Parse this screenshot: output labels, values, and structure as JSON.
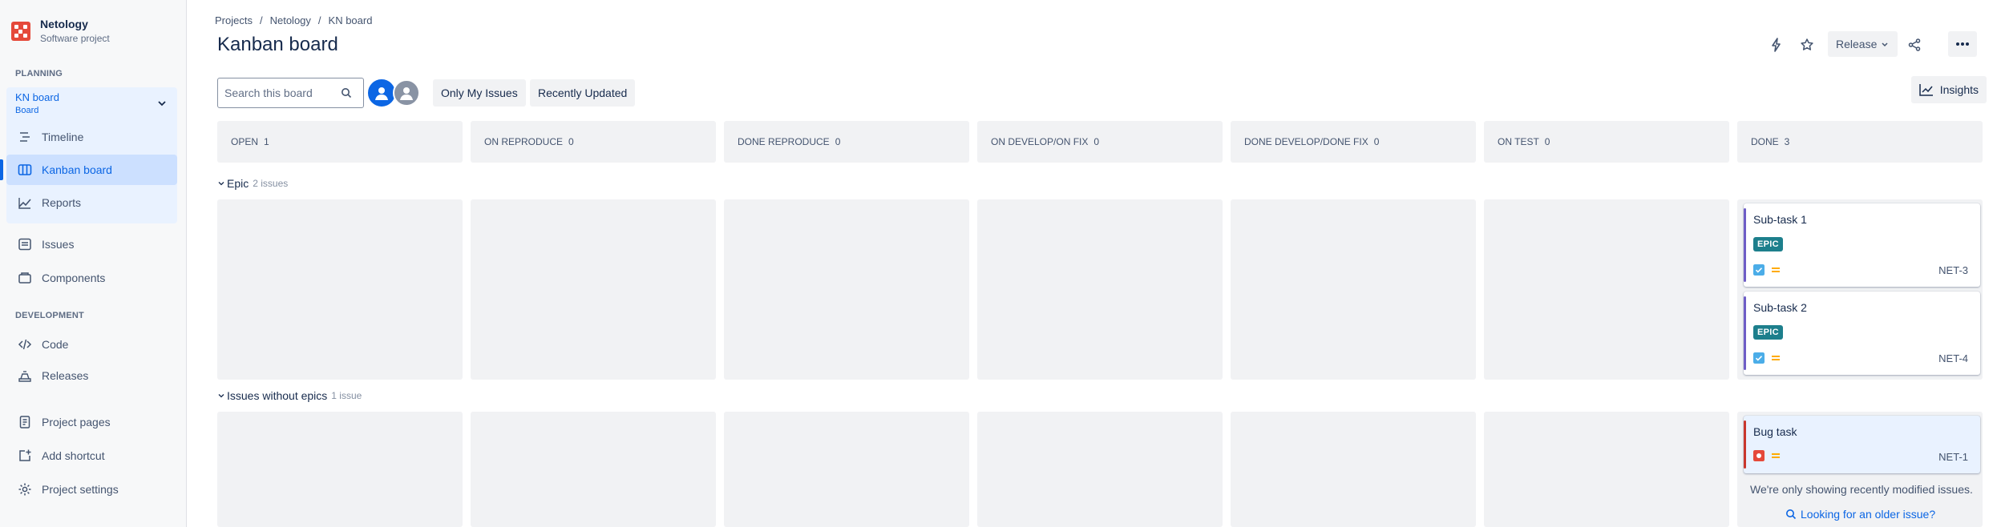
{
  "project": {
    "name": "Netology",
    "type": "Software project"
  },
  "sidebar": {
    "planning_heading": "PLANNING",
    "board": {
      "name": "KN board",
      "type": "Board"
    },
    "planning_items": [
      {
        "label": "Timeline",
        "icon": "timeline-icon"
      },
      {
        "label": "Kanban board",
        "icon": "board-icon",
        "active": true
      },
      {
        "label": "Reports",
        "icon": "reports-icon"
      }
    ],
    "other_items": [
      {
        "label": "Issues",
        "icon": "issues-icon"
      },
      {
        "label": "Components",
        "icon": "components-icon"
      }
    ],
    "development_heading": "DEVELOPMENT",
    "development_items": [
      {
        "label": "Code",
        "icon": "code-icon"
      },
      {
        "label": "Releases",
        "icon": "releases-icon"
      }
    ],
    "bottom_items": [
      {
        "label": "Project pages",
        "icon": "pages-icon"
      },
      {
        "label": "Add shortcut",
        "icon": "add-shortcut-icon"
      },
      {
        "label": "Project settings",
        "icon": "settings-icon"
      }
    ]
  },
  "breadcrumbs": [
    "Projects",
    "Netology",
    "KN board"
  ],
  "page_title": "Kanban board",
  "header_actions": {
    "release_label": "Release"
  },
  "toolbar": {
    "search_placeholder": "Search this board",
    "only_my_issues": "Only My Issues",
    "recently_updated": "Recently Updated",
    "insights": "Insights"
  },
  "columns": [
    {
      "name": "OPEN",
      "count": "1"
    },
    {
      "name": "ON REPRODUCE",
      "count": "0"
    },
    {
      "name": "DONE REPRODUCE",
      "count": "0"
    },
    {
      "name": "ON DEVELOP/ON FIX",
      "count": "0"
    },
    {
      "name": "DONE DEVELOP/DONE FIX",
      "count": "0"
    },
    {
      "name": "ON TEST",
      "count": "0"
    },
    {
      "name": "DONE",
      "count": "3"
    }
  ],
  "swimlanes": [
    {
      "name": "Epic",
      "meta": "2 issues"
    },
    {
      "name": "Issues without epics",
      "meta": "1 issue"
    }
  ],
  "cards": [
    {
      "title": "Sub-task 1",
      "label": "EPIC",
      "key": "NET-3",
      "type": "subtask"
    },
    {
      "title": "Sub-task 2",
      "label": "EPIC",
      "key": "NET-4",
      "type": "subtask"
    },
    {
      "title": "Bug task",
      "key": "NET-1",
      "type": "bug"
    }
  ],
  "footer_note": "We're only showing recently modified issues.",
  "older_link": "Looking for an older issue?",
  "colors": {
    "accent": "#0c66e4",
    "epic_label": "#1d7f8c",
    "bug": "#e5493a",
    "priority": "#ffab00"
  }
}
